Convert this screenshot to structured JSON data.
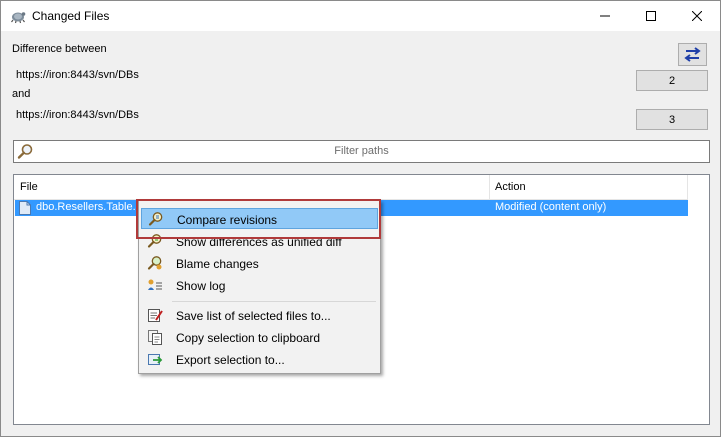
{
  "window": {
    "title": "Changed Files",
    "icon": "tortoise-svn-icon",
    "controls": [
      "minimize",
      "maximize",
      "close"
    ]
  },
  "compare": {
    "heading": "Difference between",
    "url_from": "https://iron:8443/svn/DBs",
    "and_label": "and",
    "url_to": "https://iron:8443/svn/DBs",
    "rev_from": "2",
    "rev_to": "3",
    "swap_icon": "swap-arrows-icon"
  },
  "filter": {
    "placeholder": "Filter paths",
    "icon": "search-icon"
  },
  "file_list": {
    "columns": [
      "File",
      "Action"
    ],
    "rows": [
      {
        "file": "dbo.Resellers.Table.sql",
        "action": "Modified (content only)",
        "selected": true
      }
    ],
    "selection_color": "#3399ff"
  },
  "context_menu": {
    "items": [
      {
        "label": "Compare revisions",
        "icon": "compare-icon",
        "highlighted": true
      },
      {
        "label": "Show differences as unified diff",
        "icon": "diff-icon"
      },
      {
        "label": "Blame changes",
        "icon": "blame-icon"
      },
      {
        "label": "Show log",
        "icon": "log-icon"
      },
      {
        "separator": true
      },
      {
        "label": "Save list of selected files to...",
        "icon": "save-list-icon"
      },
      {
        "label": "Copy selection to clipboard",
        "icon": "copy-icon"
      },
      {
        "label": "Export selection to...",
        "icon": "export-icon"
      }
    ],
    "highlight_outline_color": "#b03a3a"
  }
}
